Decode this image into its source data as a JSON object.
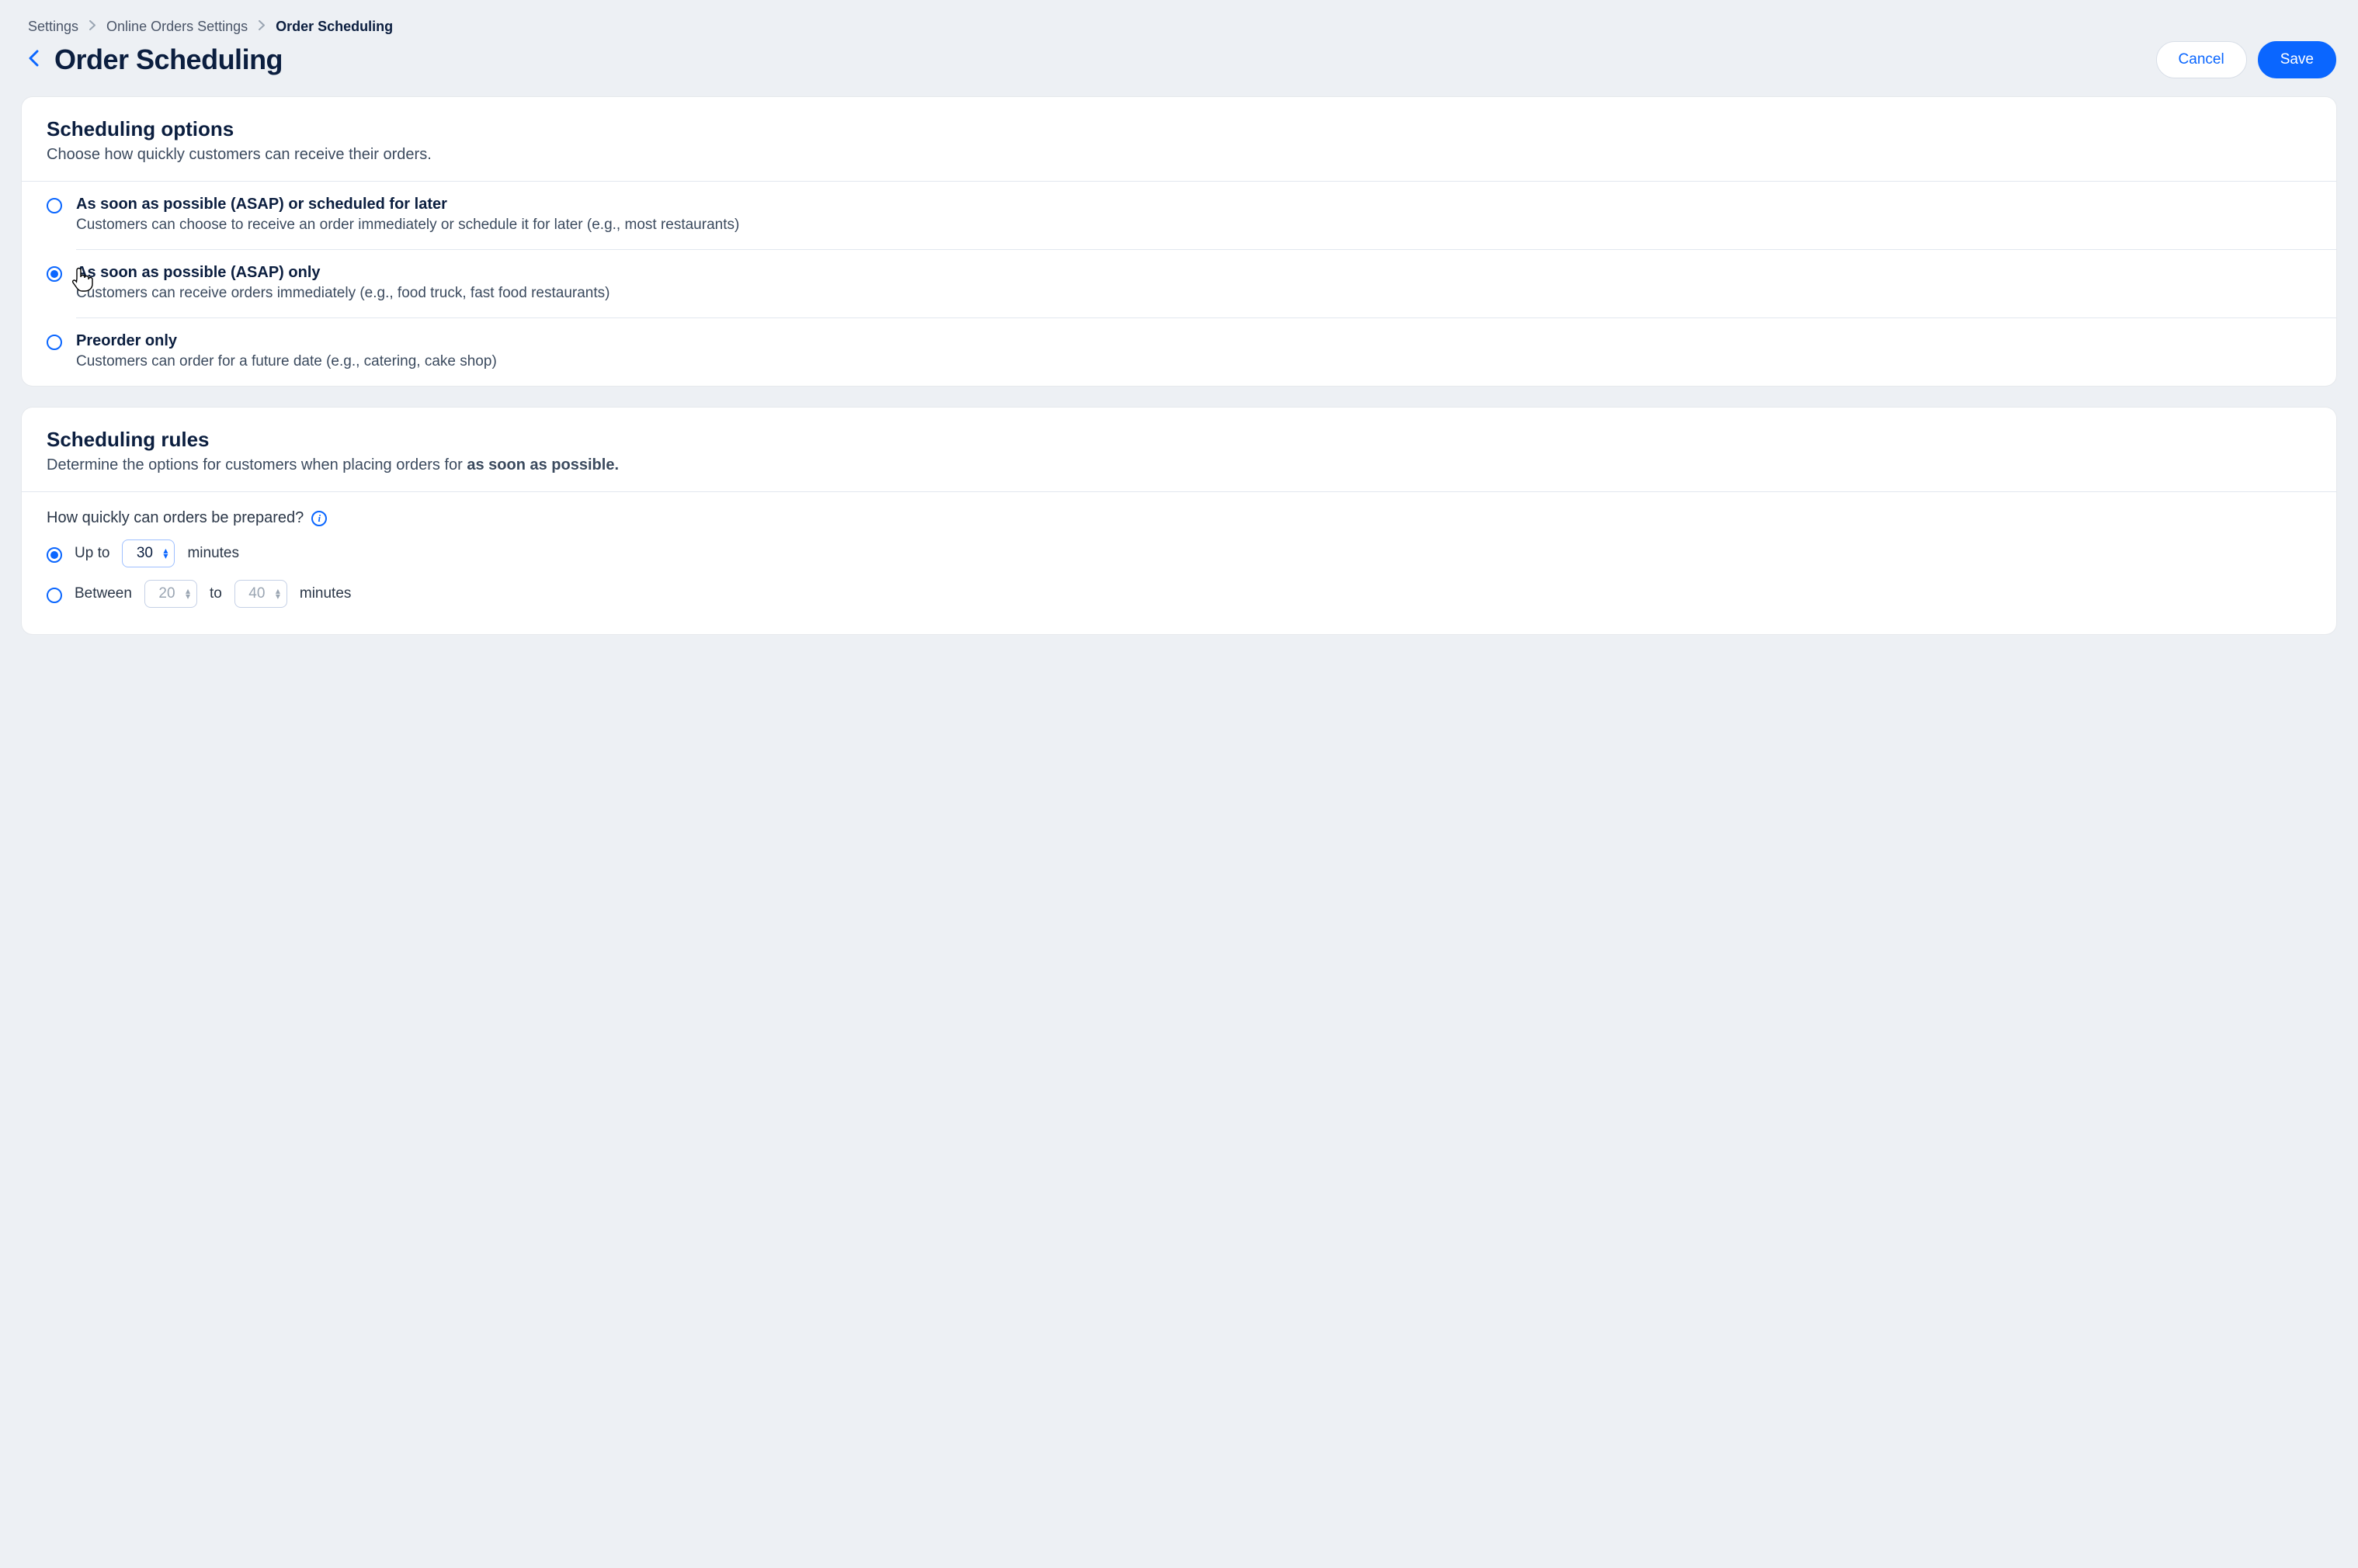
{
  "breadcrumb": {
    "a": "Settings",
    "b": "Online Orders Settings",
    "c": "Order Scheduling"
  },
  "page": {
    "title": "Order Scheduling"
  },
  "actions": {
    "cancel": "Cancel",
    "save": "Save"
  },
  "schedOptions": {
    "heading": "Scheduling options",
    "sub": "Choose how quickly customers can receive their orders.",
    "opt1": {
      "label": "As soon as possible (ASAP) or scheduled for later",
      "desc": "Customers can choose to receive an order immediately or schedule it for later (e.g., most restaurants)"
    },
    "opt2": {
      "label": "As soon as possible (ASAP)  only",
      "desc": "Customers can receive orders immediately (e.g., food truck, fast food restaurants)"
    },
    "opt3": {
      "label": "Preorder only",
      "desc": "Customers can order for a future date (e.g., catering, cake shop)"
    }
  },
  "schedRules": {
    "heading": "Scheduling rules",
    "sub_a": "Determine the options for customers when placing orders for ",
    "sub_b": "as soon as possible.",
    "question": "How quickly can orders be prepared?",
    "upTo": {
      "label": "Up to",
      "value": "30",
      "unit": "minutes"
    },
    "between": {
      "label": "Between",
      "from": "20",
      "to_word": "to",
      "to": "40",
      "unit": "minutes"
    }
  }
}
